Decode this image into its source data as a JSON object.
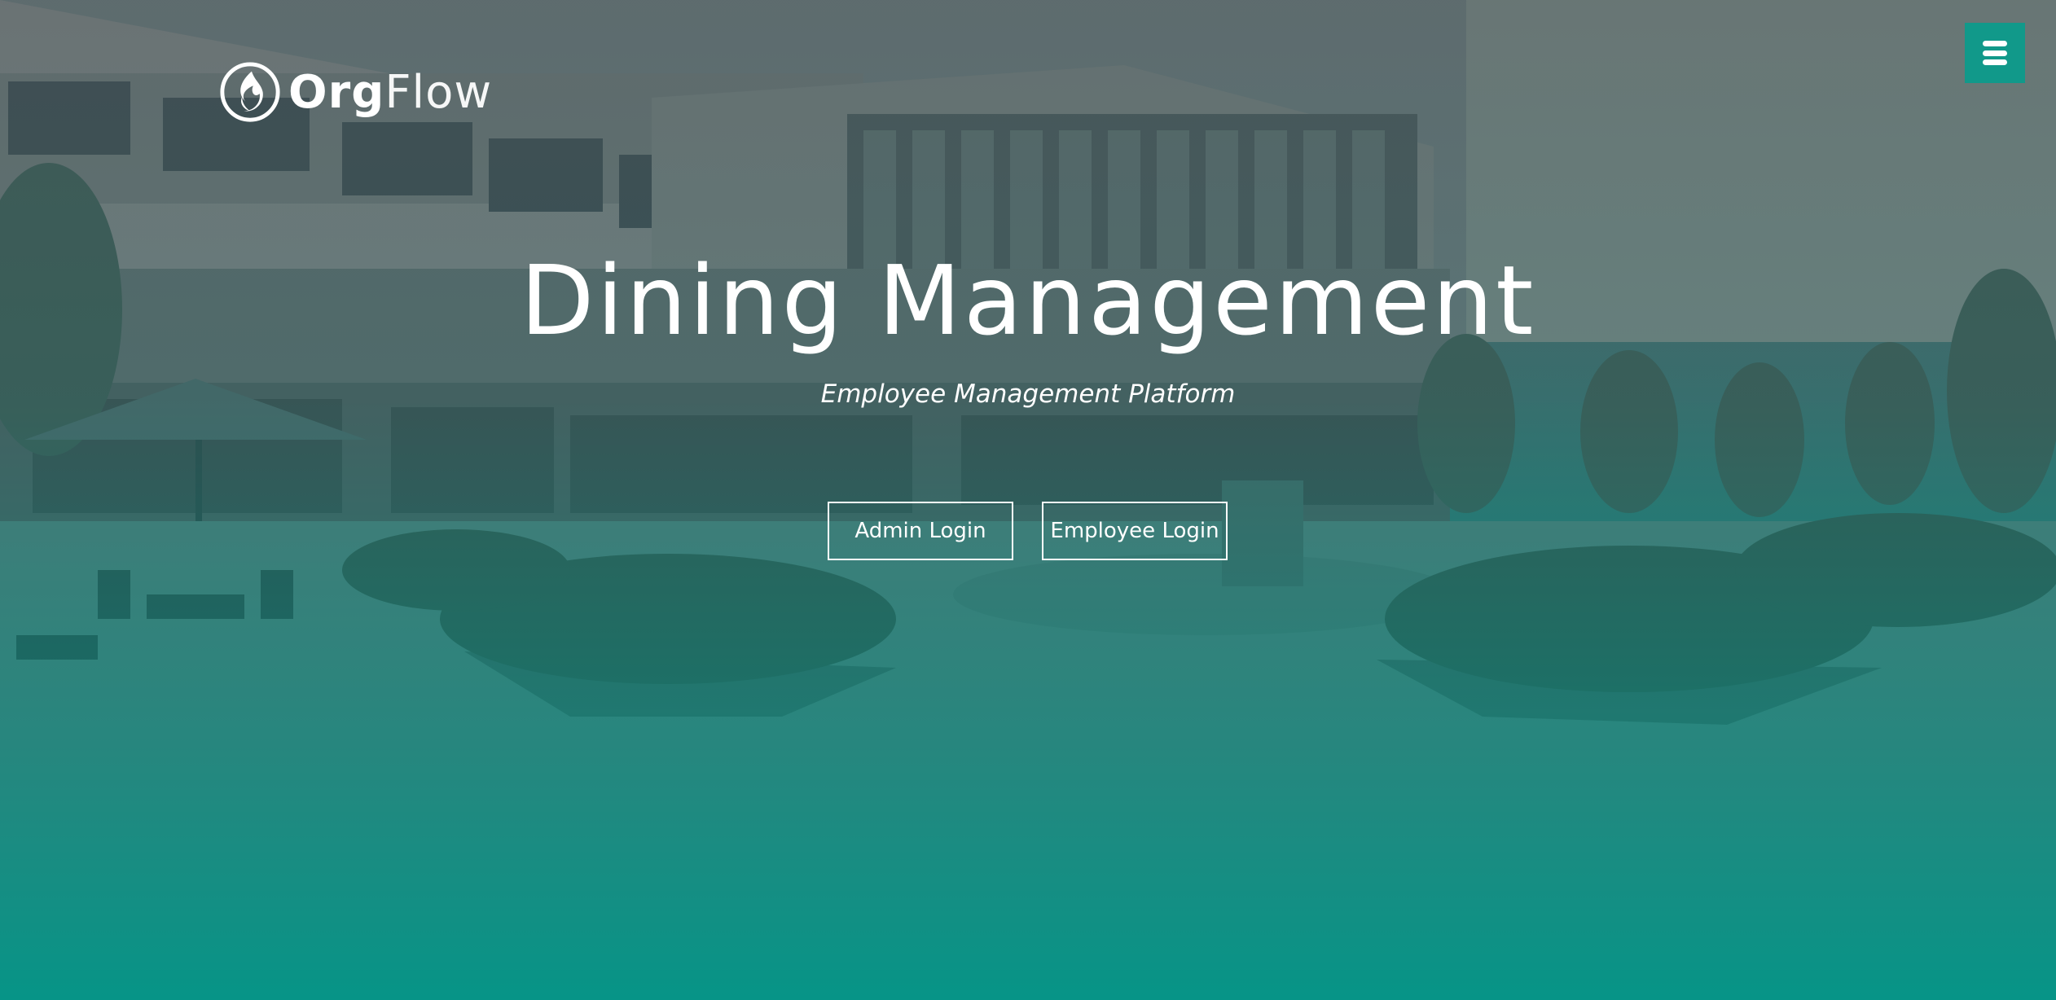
{
  "brand": {
    "name_bold": "Org",
    "name_light": "Flow",
    "logo_icon": "flame-logo-icon"
  },
  "header": {
    "menu_icon": "hamburger-menu-icon",
    "menu_color": "#11998a"
  },
  "hero": {
    "title": "Dining Management",
    "subtitle": "Employee Management Platform",
    "background_description_icon": "campus-building-photo"
  },
  "actions": {
    "admin_login_label": "Admin Login",
    "employee_login_label": "Employee Login"
  },
  "colors": {
    "accent": "#11998a",
    "gradient_bottom": "#05968a",
    "text": "#ffffff"
  }
}
